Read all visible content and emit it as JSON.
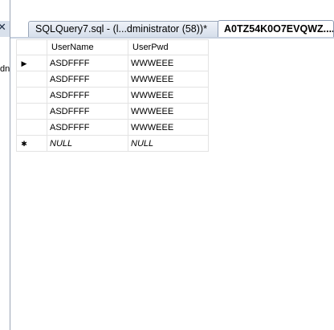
{
  "left_panel": {
    "close_glyph": "✕",
    "clipped_text": "dn"
  },
  "tabs": [
    {
      "label": "SQLQuery7.sql - (l...dministrator (58))*",
      "active": false
    },
    {
      "label": "A0TZ54K0O7EVQWZ....",
      "active": true
    }
  ],
  "grid": {
    "columns": [
      "UserName",
      "UserPwd"
    ],
    "rows": [
      {
        "marker": "current-row-arrow",
        "glyph": "▶",
        "cells": [
          "ASDFFFF",
          "WWWEEE"
        ]
      },
      {
        "marker": "",
        "glyph": "",
        "cells": [
          "ASDFFFF",
          "WWWEEE"
        ]
      },
      {
        "marker": "",
        "glyph": "",
        "cells": [
          "ASDFFFF",
          "WWWEEE"
        ]
      },
      {
        "marker": "",
        "glyph": "",
        "cells": [
          "ASDFFFF",
          "WWWEEE"
        ]
      },
      {
        "marker": "",
        "glyph": "",
        "cells": [
          "ASDFFFF",
          "WWWEEE"
        ]
      }
    ],
    "new_row": {
      "glyph": "✱",
      "cells": [
        "NULL",
        "NULL"
      ]
    }
  }
}
